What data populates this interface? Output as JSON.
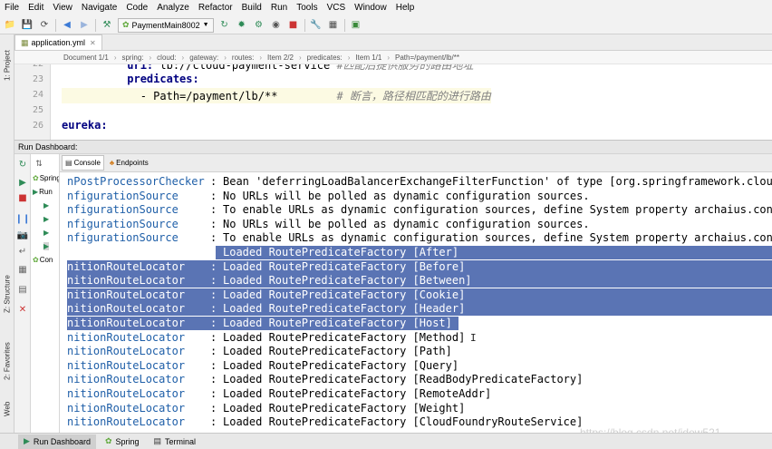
{
  "menu": [
    "File",
    "Edit",
    "View",
    "Navigate",
    "Code",
    "Analyze",
    "Refactor",
    "Build",
    "Run",
    "Tools",
    "VCS",
    "Window",
    "Help"
  ],
  "toolbar": {
    "run_config": "PaymentMain8002"
  },
  "left_tabs": {
    "project": "1: Project",
    "structure": "Z: Structure",
    "favorites": "2: Favorites",
    "web": "Web"
  },
  "editor_tab": {
    "name": "application.yml"
  },
  "breadcrumb": [
    "Document 1/1",
    "spring:",
    "cloud:",
    "gateway:",
    "routes:",
    "Item 2/2",
    "predicates:",
    "Item 1/1",
    "Path=/payment/lb/**"
  ],
  "editor": {
    "lines": [
      {
        "no": "22",
        "key": "uri:",
        "value": " lb://cloud-payment-service",
        "comment": " #匹配后提供服务的路由地址",
        "indent": "          "
      },
      {
        "no": "23",
        "key": "predicates:",
        "value": "",
        "comment": "",
        "indent": "          "
      },
      {
        "no": "24",
        "key": "",
        "value": "- Path=/payment/lb/**",
        "comment": "         # 断言，路径相匹配的进行路由",
        "indent": "            "
      },
      {
        "no": "25",
        "key": "",
        "value": "",
        "comment": "",
        "indent": ""
      },
      {
        "no": "26",
        "key": "eureka:",
        "value": "",
        "comment": "",
        "indent": ""
      }
    ]
  },
  "run_dashboard": {
    "title": "Run Dashboard:",
    "tree": [
      "Spring",
      "Run",
      "Con"
    ],
    "tabs": {
      "console": "Console",
      "endpoints": "Endpoints"
    }
  },
  "console": {
    "lines": [
      {
        "src": "nPostProcessorChecker",
        "msg": "Bean 'deferringLoadBalancerExchangeFilterFunction' of type [org.springframework.cloud",
        "selected": false
      },
      {
        "src": "nfigurationSource",
        "msg": "No URLs will be polled as dynamic configuration sources.",
        "selected": false
      },
      {
        "src": "nfigurationSource",
        "msg": "To enable URLs as dynamic configuration sources, define System property archaius.conf",
        "selected": false
      },
      {
        "src": "nfigurationSource",
        "msg": "No URLs will be polled as dynamic configuration sources.",
        "selected": false
      },
      {
        "src": "nfigurationSource",
        "msg": "To enable URLs as dynamic configuration sources, define System property archaius.conf",
        "selected": false
      },
      {
        "src": "nitionRouteLocator",
        "msg": "Loaded RoutePredicateFactory [After]",
        "selected": true
      },
      {
        "src": "nitionRouteLocator",
        "msg": "Loaded RoutePredicateFactory [Before]",
        "selected": true
      },
      {
        "src": "nitionRouteLocator",
        "msg": "Loaded RoutePredicateFactory [Between]",
        "selected": true
      },
      {
        "src": "nitionRouteLocator",
        "msg": "Loaded RoutePredicateFactory [Cookie]",
        "selected": true
      },
      {
        "src": "nitionRouteLocator",
        "msg": "Loaded RoutePredicateFactory [Header]",
        "selected": true
      },
      {
        "src": "nitionRouteLocator",
        "msg": "Loaded RoutePredicateFactory [Host]",
        "selected": true
      },
      {
        "src": "nitionRouteLocator",
        "msg": "Loaded RoutePredicateFactory [Method]",
        "selected": false
      },
      {
        "src": "nitionRouteLocator",
        "msg": "Loaded RoutePredicateFactory [Path]",
        "selected": false
      },
      {
        "src": "nitionRouteLocator",
        "msg": "Loaded RoutePredicateFactory [Query]",
        "selected": false
      },
      {
        "src": "nitionRouteLocator",
        "msg": "Loaded RoutePredicateFactory [ReadBodyPredicateFactory]",
        "selected": false
      },
      {
        "src": "nitionRouteLocator",
        "msg": "Loaded RoutePredicateFactory [RemoteAddr]",
        "selected": false
      },
      {
        "src": "nitionRouteLocator",
        "msg": "Loaded RoutePredicateFactory [Weight]",
        "selected": false
      },
      {
        "src": "nitionRouteLocator",
        "msg": "Loaded RoutePredicateFactory [CloudFoundryRouteService]",
        "selected": false
      }
    ]
  },
  "watermark": "https://blog.csdn.net/idew521",
  "bottom_bar": {
    "run_dashboard": "Run Dashboard",
    "spring": "Spring",
    "terminal": "Terminal"
  },
  "colors": {
    "selection": "#5a74b4",
    "log_source": "#1f5fa8",
    "yaml_key": "#000080"
  }
}
